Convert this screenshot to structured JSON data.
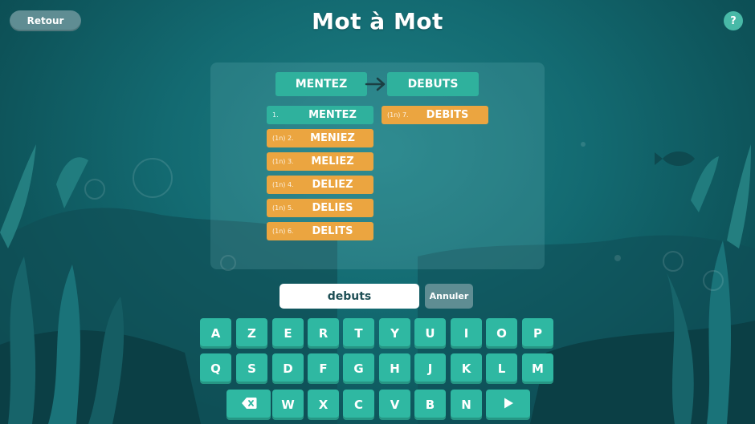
{
  "app": {
    "title": "Mot à Mot"
  },
  "header": {
    "back_label": "Retour",
    "help_label": "?"
  },
  "puzzle": {
    "start_word": "MENTEZ",
    "target_word": "DEBUTS",
    "steps": [
      {
        "index": "1.",
        "word": "MENTEZ",
        "state": "done"
      },
      {
        "index": "(1n) 2.",
        "word": "MENIEZ",
        "state": "move"
      },
      {
        "index": "(1n) 3.",
        "word": "MELIEZ",
        "state": "move"
      },
      {
        "index": "(1n) 4.",
        "word": "DELIEZ",
        "state": "move"
      },
      {
        "index": "(1n) 5.",
        "word": "DELIES",
        "state": "move"
      },
      {
        "index": "(1n) 6.",
        "word": "DELITS",
        "state": "move"
      },
      {
        "index": "(1n) 7.",
        "word": "DEBITS",
        "state": "move"
      }
    ]
  },
  "input": {
    "value": "debuts",
    "cancel_label": "Annuler"
  },
  "keyboard": {
    "row1": [
      "A",
      "Z",
      "E",
      "R",
      "T",
      "Y",
      "U",
      "I",
      "O",
      "P"
    ],
    "row2": [
      "Q",
      "S",
      "D",
      "F",
      "G",
      "H",
      "J",
      "K",
      "L",
      "M"
    ],
    "row3": [
      "W",
      "X",
      "C",
      "V",
      "B",
      "N"
    ],
    "backspace_icon": "backspace-icon",
    "submit_icon": "play-icon"
  },
  "colors": {
    "background": "#136a71",
    "key": "#2fb8a2",
    "word_green": "#2fb19d",
    "word_orange": "#eba540"
  }
}
